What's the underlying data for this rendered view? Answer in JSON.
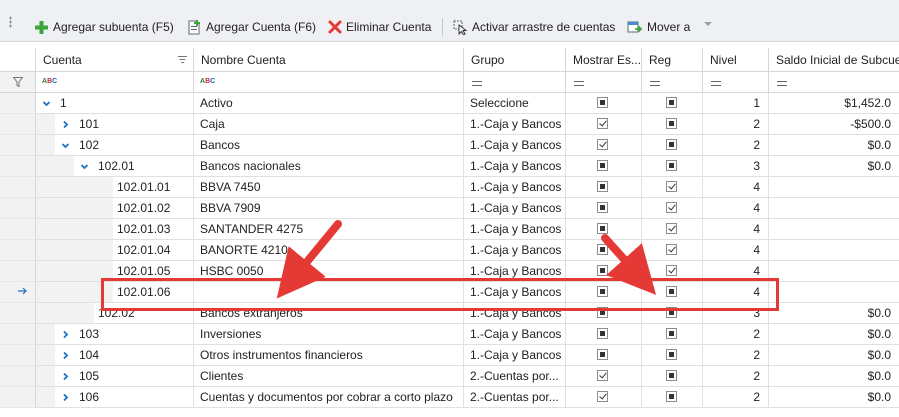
{
  "toolbar": {
    "add_subaccount": "Agregar subuenta (F5)",
    "add_account": "Agregar Cuenta (F6)",
    "delete_account": "Eliminar Cuenta",
    "activate_drag": "Activar arrastre de cuentas",
    "move_to": "Mover a"
  },
  "columns": {
    "cuenta": "Cuenta",
    "nombre": "Nombre Cuenta",
    "grupo": "Grupo",
    "mostrar": "Mostrar Es...",
    "reg": "Reg",
    "nivel": "Nivel",
    "saldo": "Saldo Inicial de Subcuenta"
  },
  "rows": [
    {
      "cuenta": "1",
      "nombre": "Activo",
      "grupo": "Seleccione",
      "mostrar": "indeterminate",
      "reg": "indeterminate",
      "nivel": "1",
      "saldo": "$1,452.0",
      "level": 0,
      "expander": "expanded"
    },
    {
      "cuenta": "101",
      "nombre": "Caja",
      "grupo": "1.-Caja y Bancos",
      "mostrar": "checked",
      "reg": "indeterminate",
      "nivel": "2",
      "saldo": "-$500.0",
      "level": 1,
      "expander": "collapsed"
    },
    {
      "cuenta": "102",
      "nombre": "Bancos",
      "grupo": "1.-Caja y Bancos",
      "mostrar": "checked",
      "reg": "indeterminate",
      "nivel": "2",
      "saldo": "$0.0",
      "level": 1,
      "expander": "expanded"
    },
    {
      "cuenta": "102.01",
      "nombre": "Bancos nacionales",
      "grupo": "1.-Caja y Bancos",
      "mostrar": "indeterminate",
      "reg": "indeterminate",
      "nivel": "3",
      "saldo": "$0.0",
      "level": 2,
      "expander": "expanded"
    },
    {
      "cuenta": "102.01.01",
      "nombre": "BBVA 7450",
      "grupo": "1.-Caja y Bancos",
      "mostrar": "indeterminate",
      "reg": "checked",
      "nivel": "4",
      "saldo": "",
      "level": 3,
      "expander": "none"
    },
    {
      "cuenta": "102.01.02",
      "nombre": "BBVA 7909",
      "grupo": "1.-Caja y Bancos",
      "mostrar": "indeterminate",
      "reg": "checked",
      "nivel": "4",
      "saldo": "",
      "level": 3,
      "expander": "none"
    },
    {
      "cuenta": "102.01.03",
      "nombre": "SANTANDER 4275",
      "grupo": "1.-Caja y Bancos",
      "mostrar": "indeterminate",
      "reg": "checked",
      "nivel": "4",
      "saldo": "",
      "level": 3,
      "expander": "none"
    },
    {
      "cuenta": "102.01.04",
      "nombre": "BANORTE 4210",
      "grupo": "1.-Caja y Bancos",
      "mostrar": "indeterminate",
      "reg": "checked",
      "nivel": "4",
      "saldo": "",
      "level": 3,
      "expander": "none"
    },
    {
      "cuenta": "102.01.05",
      "nombre": "HSBC 0050",
      "grupo": "1.-Caja y Bancos",
      "mostrar": "indeterminate",
      "reg": "checked",
      "nivel": "4",
      "saldo": "",
      "level": 3,
      "expander": "none"
    },
    {
      "cuenta": "102.01.06",
      "nombre": "",
      "grupo": "1.-Caja y Bancos",
      "mostrar": "indeterminate",
      "reg": "indeterminate",
      "nivel": "4",
      "saldo": "",
      "level": 3,
      "expander": "none",
      "current": true
    },
    {
      "cuenta": "102.02",
      "nombre": "Bancos extranjeros",
      "grupo": "1.-Caja y Bancos",
      "mostrar": "indeterminate",
      "reg": "indeterminate",
      "nivel": "3",
      "saldo": "$0.0",
      "level": 2,
      "expander": "none"
    },
    {
      "cuenta": "103",
      "nombre": "Inversiones",
      "grupo": "1.-Caja y Bancos",
      "mostrar": "indeterminate",
      "reg": "indeterminate",
      "nivel": "2",
      "saldo": "$0.0",
      "level": 1,
      "expander": "collapsed"
    },
    {
      "cuenta": "104",
      "nombre": "Otros instrumentos financieros",
      "grupo": "1.-Caja y Bancos",
      "mostrar": "indeterminate",
      "reg": "indeterminate",
      "nivel": "2",
      "saldo": "$0.0",
      "level": 1,
      "expander": "collapsed"
    },
    {
      "cuenta": "105",
      "nombre": "Clientes",
      "grupo": "2.-Cuentas por...",
      "mostrar": "checked",
      "reg": "indeterminate",
      "nivel": "2",
      "saldo": "$0.0",
      "level": 1,
      "expander": "collapsed"
    },
    {
      "cuenta": "106",
      "nombre": "Cuentas y documentos por cobrar a corto plazo",
      "grupo": "2.-Cuentas por...",
      "mostrar": "checked",
      "reg": "indeterminate",
      "nivel": "2",
      "saldo": "$0.0",
      "level": 1,
      "expander": "collapsed"
    }
  ],
  "colors": {
    "annotation_red": "#e53935",
    "expander_blue": "#1e73be",
    "toolbar_bg": "#eef0f3"
  },
  "icons": {
    "add_subaccount": "green-plus-icon",
    "add_account": "add-document-icon",
    "delete_account": "red-x-icon",
    "activate_drag": "cursor-drag-icon",
    "move_to": "move-icon",
    "filter": "funnel-icon"
  }
}
